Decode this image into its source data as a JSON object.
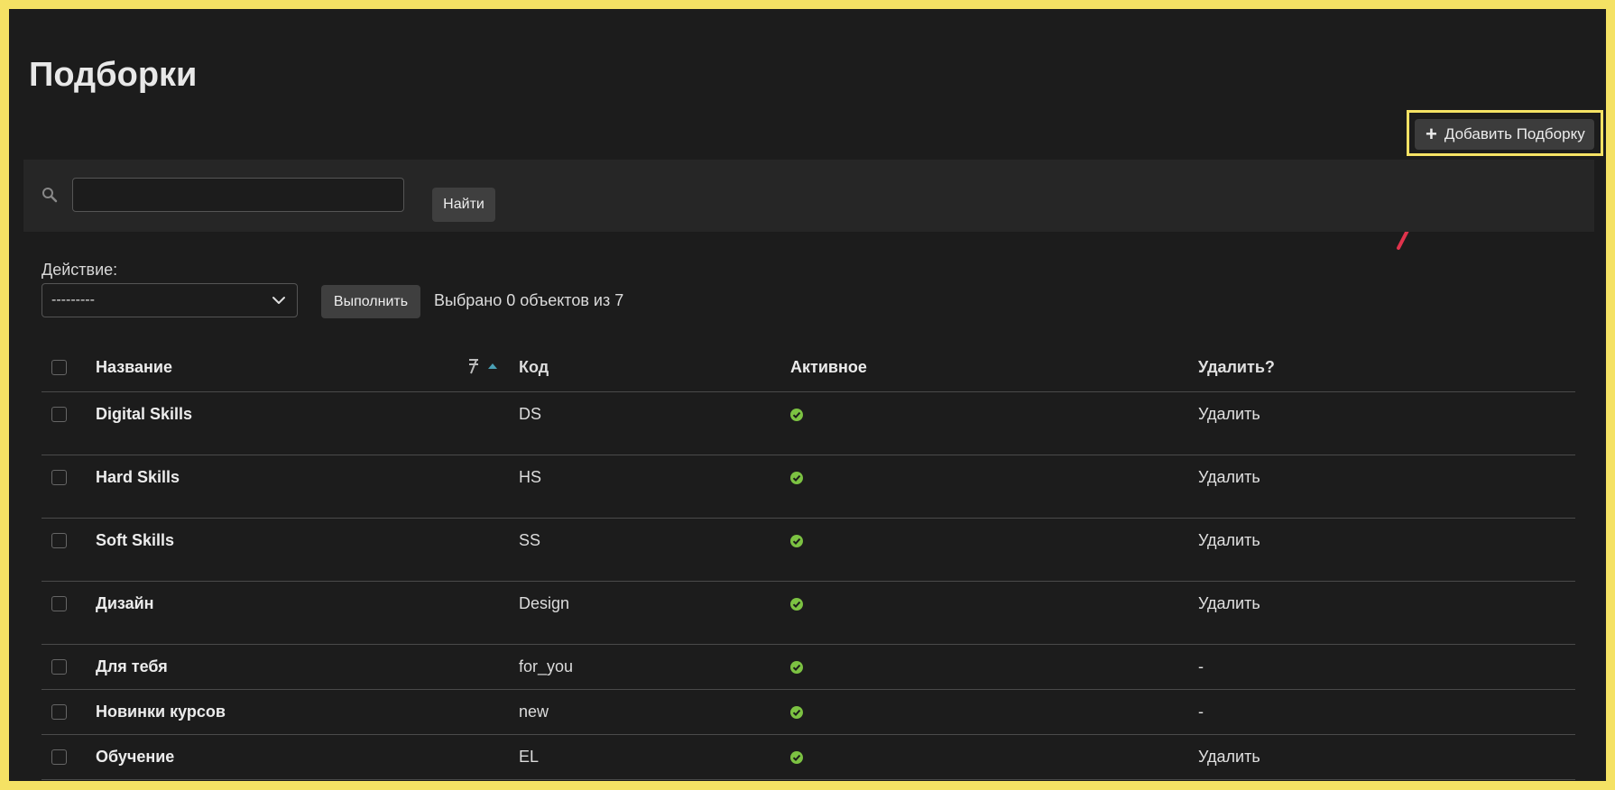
{
  "page": {
    "title": "Подборки"
  },
  "toolbar": {
    "add_label": "Добавить Подборку"
  },
  "search": {
    "button_label": "Найти",
    "value": ""
  },
  "actions": {
    "label": "Действие:",
    "selected_option": "---------",
    "run_label": "Выполнить",
    "selected_count_text": "Выбрано 0 объектов из 7"
  },
  "table": {
    "columns": {
      "name": "Название",
      "code": "Код",
      "active": "Активное",
      "delete": "Удалить?"
    },
    "rows": [
      {
        "name": "Digital Skills",
        "code": "DS",
        "active": true,
        "delete": "Удалить"
      },
      {
        "name": "Hard Skills",
        "code": "HS",
        "active": true,
        "delete": "Удалить"
      },
      {
        "name": "Soft Skills",
        "code": "SS",
        "active": true,
        "delete": "Удалить"
      },
      {
        "name": "Дизайн",
        "code": "Design",
        "active": true,
        "delete": "Удалить"
      },
      {
        "name": "Для тебя",
        "code": "for_you",
        "active": true,
        "delete": "-"
      },
      {
        "name": "Новинки курсов",
        "code": "new",
        "active": true,
        "delete": "-"
      },
      {
        "name": "Обучение",
        "code": "EL",
        "active": true,
        "delete": "Удалить"
      }
    ]
  },
  "colors": {
    "highlight": "#f5e264",
    "arrow": "#e0334c",
    "check": "#7cc242"
  },
  "icons": [
    "plus-icon",
    "search-icon",
    "chevron-down-icon",
    "sort-icon",
    "sort-asc-icon",
    "check-circle-icon",
    "arrow-icon"
  ]
}
